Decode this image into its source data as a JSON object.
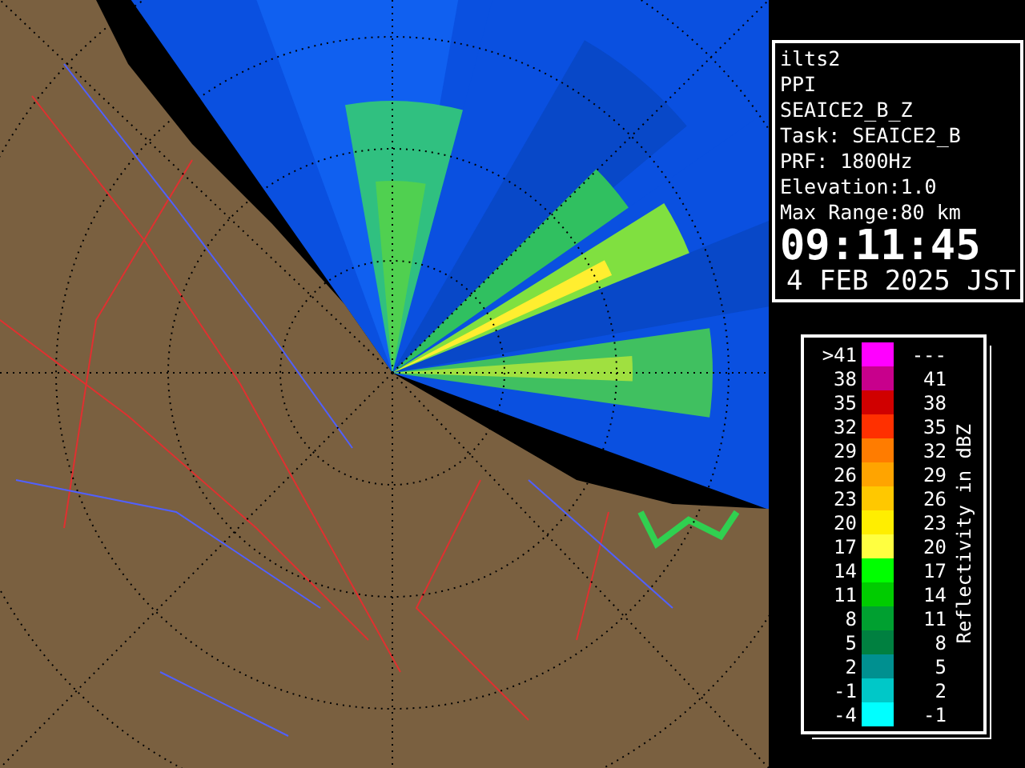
{
  "info_panel": {
    "lines": [
      "ilts2",
      "PPI",
      "SEAICE2_B_Z",
      "Task: SEAICE2_B",
      "PRF: 1800Hz",
      "Elevation:1.0",
      "Max Range:80 km"
    ],
    "time": "09:11:45",
    "date": "4 FEB 2025 JST"
  },
  "legend": {
    "title": "Reflectivity in dBZ",
    "rows": [
      {
        "low": ">41",
        "high": "---",
        "color": "#ff00ff"
      },
      {
        "low": "38",
        "high": "41",
        "color": "#c8008c"
      },
      {
        "low": "35",
        "high": "38",
        "color": "#d00000"
      },
      {
        "low": "32",
        "high": "35",
        "color": "#ff3000"
      },
      {
        "low": "29",
        "high": "32",
        "color": "#ff7c00"
      },
      {
        "low": "26",
        "high": "29",
        "color": "#ffa400"
      },
      {
        "low": "23",
        "high": "26",
        "color": "#ffc800"
      },
      {
        "low": "20",
        "high": "23",
        "color": "#ffee00"
      },
      {
        "low": "17",
        "high": "20",
        "color": "#ffff40"
      },
      {
        "low": "14",
        "high": "17",
        "color": "#00ff00"
      },
      {
        "low": "11",
        "high": "14",
        "color": "#00cc00"
      },
      {
        "low": "8",
        "high": "11",
        "color": "#00a030"
      },
      {
        "low": "5",
        "high": "8",
        "color": "#008040"
      },
      {
        "low": "2",
        "high": "5",
        "color": "#009090"
      },
      {
        "low": "-1",
        "high": "2",
        "color": "#00c8c8"
      },
      {
        "low": "-4",
        "high": "-1",
        "color": "#00ffff"
      }
    ]
  }
}
